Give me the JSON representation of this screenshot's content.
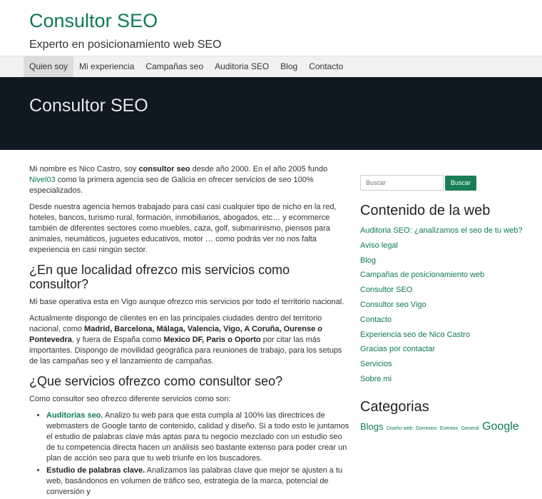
{
  "header": {
    "site_title": "Consultor SEO",
    "tagline": "Experto en posicionamiento web SEO"
  },
  "nav": {
    "items": [
      {
        "label": "Quien soy",
        "active": true
      },
      {
        "label": "Mi experiencia"
      },
      {
        "label": "Campañas seo"
      },
      {
        "label": "Auditoria SEO"
      },
      {
        "label": "Blog"
      },
      {
        "label": "Contacto"
      }
    ]
  },
  "hero": {
    "title": "Consultor SEO"
  },
  "main": {
    "p1": {
      "a": "Mi nombre es Nico Castro, soy ",
      "b": "consultor seo",
      "c": " desde año 2000. En el año 2005 fundo ",
      "link": "Nivel03",
      "d": " como la primera agencia seo de Galicia en ofrecer servicios de seo 100% especializados."
    },
    "p2": "Desde nuestra agencia hemos trabajado para casi casi cualquier tipo de nicho en la red, hoteles, bancos, turismo rural, formación, inmobiliarios, abogados, etc… y ecommerce también de diferentes sectores como muebles, caza, golf, submarinismo, piensos para animales, neumáticos, juguetes educativos,  motor … como podrás ver no nos falta experiencia en casi ningún sector.",
    "h2_1": "¿En que localidad ofrezco mis servicios como consultor?",
    "p3": "Mi base operativa esta en Vigo aunque ofrezco mis servicios por todo el territorio nacional.",
    "p4": {
      "a": "Actualmente dispongo de clientes en en las principales ciudades dentro del territorio nacional, como ",
      "cities": "Madrid, Barcelona, Málaga, Valencia, Vigo, A Coruña, Ourense o  Pontevedra",
      "b": ", y fuera de España como ",
      "intl": "Mexico DF, Paris o Oporto",
      "c": " por citar las más importantes. Dispongo de movilidad geográfica para reuniones de trabajo, para los setups de las campañas seo y el  lanzamiento de campañas."
    },
    "h2_2": "¿Que servicios ofrezco como consultor seo?",
    "p5": "Como consultor seo ofrezco diferente servicios como son:",
    "list": [
      {
        "title": "Auditorias seo.",
        "text": " Analizo tu web para que esta cumpla al 100% las directrices de webmasters de Google tanto de contenido, calidad y diseño. Si a todo esto le juntamos el estudio de palabras clave más aptas para tu negocio mezclado con un estudio seo de tu competencia directa hacen un análisis seo bastante extenso para poder crear un plan de acción seo para que tu web triunfe en los buscadores."
      },
      {
        "title": "Estudio de palabras clave.",
        "text": " Analizamos las palabras clave que mejor se ajusten a tu web, basándonos en volumen de tráfico seo, estrategia de la marca, potencial de conversión y"
      }
    ]
  },
  "sidebar": {
    "search_placeholder": "Buscar",
    "search_button": "Buscar",
    "contenido_title": "Contenido de la web",
    "pages": [
      "Auditoria SEO: ¿analizamos el seo de tu web?",
      "Aviso legal",
      "Blog",
      "Campañas de posicionamiento web",
      "Consultor SEO",
      "Consultor seo Vigo",
      "Contacto",
      "Experiencia seo de Nico Castro",
      "Gracias por contactar",
      "Servicios",
      "Sobre mi"
    ],
    "categorias_title": "Categorias",
    "tags": [
      "Blogs",
      "Diseño web",
      "Dominios",
      "Eventos",
      "General",
      "Google"
    ]
  },
  "colors": {
    "accent": "#0e7a52",
    "hero_bg": "#0f1924",
    "nav_bg": "#f1f1f1"
  }
}
